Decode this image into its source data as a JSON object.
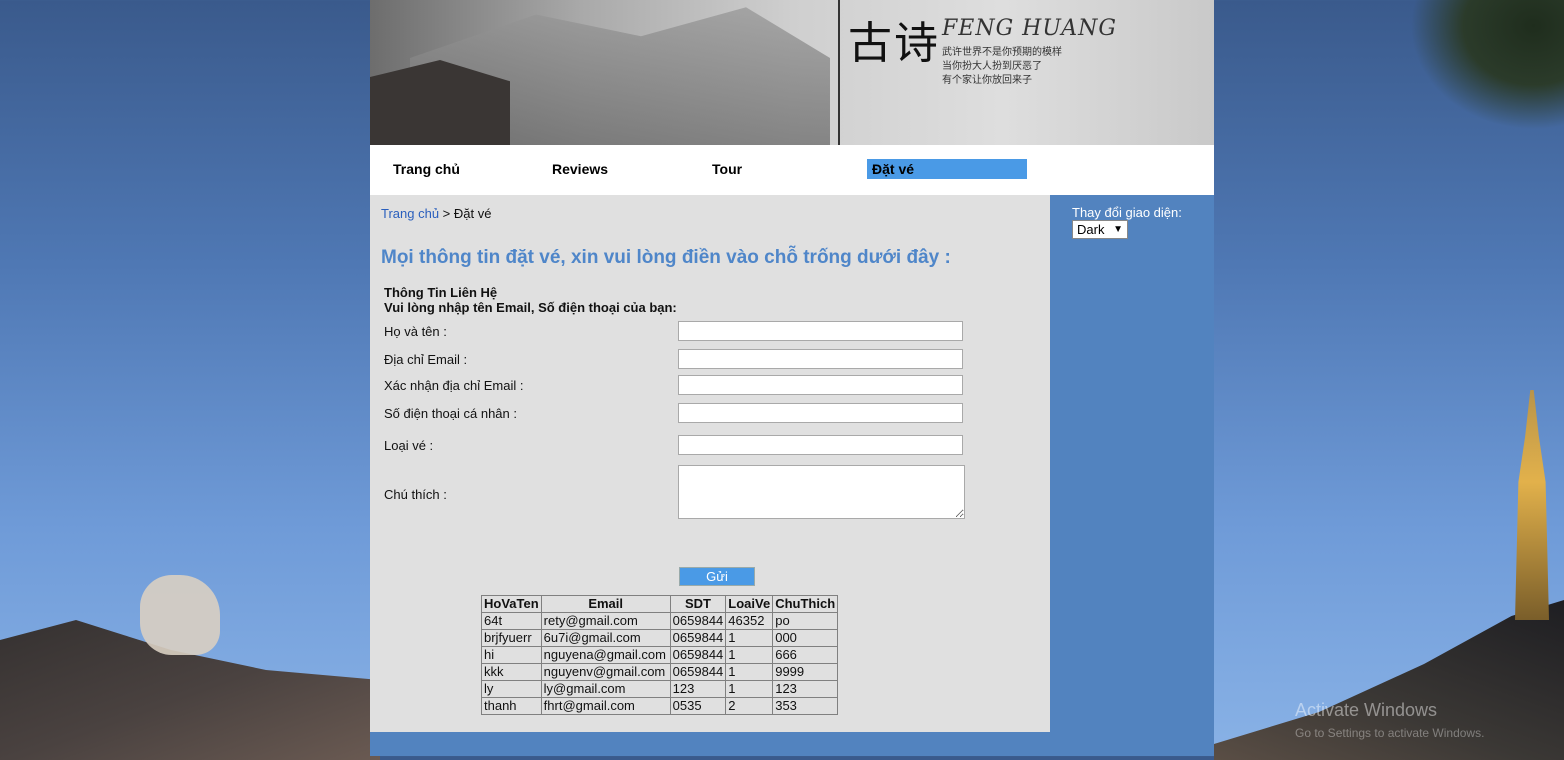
{
  "nav": {
    "items": [
      {
        "label": "Trang chủ"
      },
      {
        "label": "Reviews"
      },
      {
        "label": "Tour"
      },
      {
        "label": "Đặt vé"
      }
    ]
  },
  "banner": {
    "brand": "FENG HUANG",
    "calligraphy": "古诗",
    "poem": "武许世界不是你预期的模样\n当你扮大人扮到厌恶了\n有个家让你放回来子"
  },
  "breadcrumb": {
    "home": "Trang chủ",
    "separator": " > ",
    "current": "Đặt vé"
  },
  "form": {
    "heading": "Mọi thông tin đặt vé, xin vui lòng điền vào chỗ trống dưới đây :",
    "section_title": "Thông Tin Liên Hệ",
    "section_subtitle": "Vui lòng nhập tên Email, Số điện thoại của bạn:",
    "fields": [
      {
        "label": "Họ và tên :",
        "value": ""
      },
      {
        "label": "Địa chỉ Email :",
        "value": ""
      },
      {
        "label": "Xác nhận địa chỉ Email :",
        "value": ""
      },
      {
        "label": "Số điện thoại cá nhân :",
        "value": ""
      },
      {
        "label": "Loại vé :",
        "value": ""
      },
      {
        "label": "Chú thích :",
        "value": ""
      }
    ],
    "submit_label": "Gửi"
  },
  "table": {
    "headers": [
      "HoVaTen",
      "Email",
      "SDT",
      "LoaiVe",
      "ChuThich"
    ],
    "rows": [
      [
        "64t",
        "rety@gmail.com",
        "0659844",
        "46352",
        "po"
      ],
      [
        "brjfyuerr",
        "6u7i@gmail.com",
        "0659844",
        "1",
        "000"
      ],
      [
        "hi",
        "nguyena@gmail.com",
        "0659844",
        "1",
        "666"
      ],
      [
        "kkk",
        "nguyenv@gmail.com",
        "0659844",
        "1",
        "9999"
      ],
      [
        "ly",
        "ly@gmail.com",
        "123",
        "1",
        "123"
      ],
      [
        "thanh",
        "fhrt@gmail.com",
        "0535",
        "2",
        "353"
      ]
    ]
  },
  "sidebar": {
    "theme_label": "Thay đổi giao diện:",
    "theme_selected": "Dark"
  },
  "watermark": {
    "title": "Activate Windows",
    "subtitle": "Go to Settings to activate Windows."
  },
  "colors": {
    "accent": "#4a9ae6",
    "sidebar": "#5283bf",
    "heading": "#4f86c9",
    "content_bg": "#e0e0e0"
  }
}
